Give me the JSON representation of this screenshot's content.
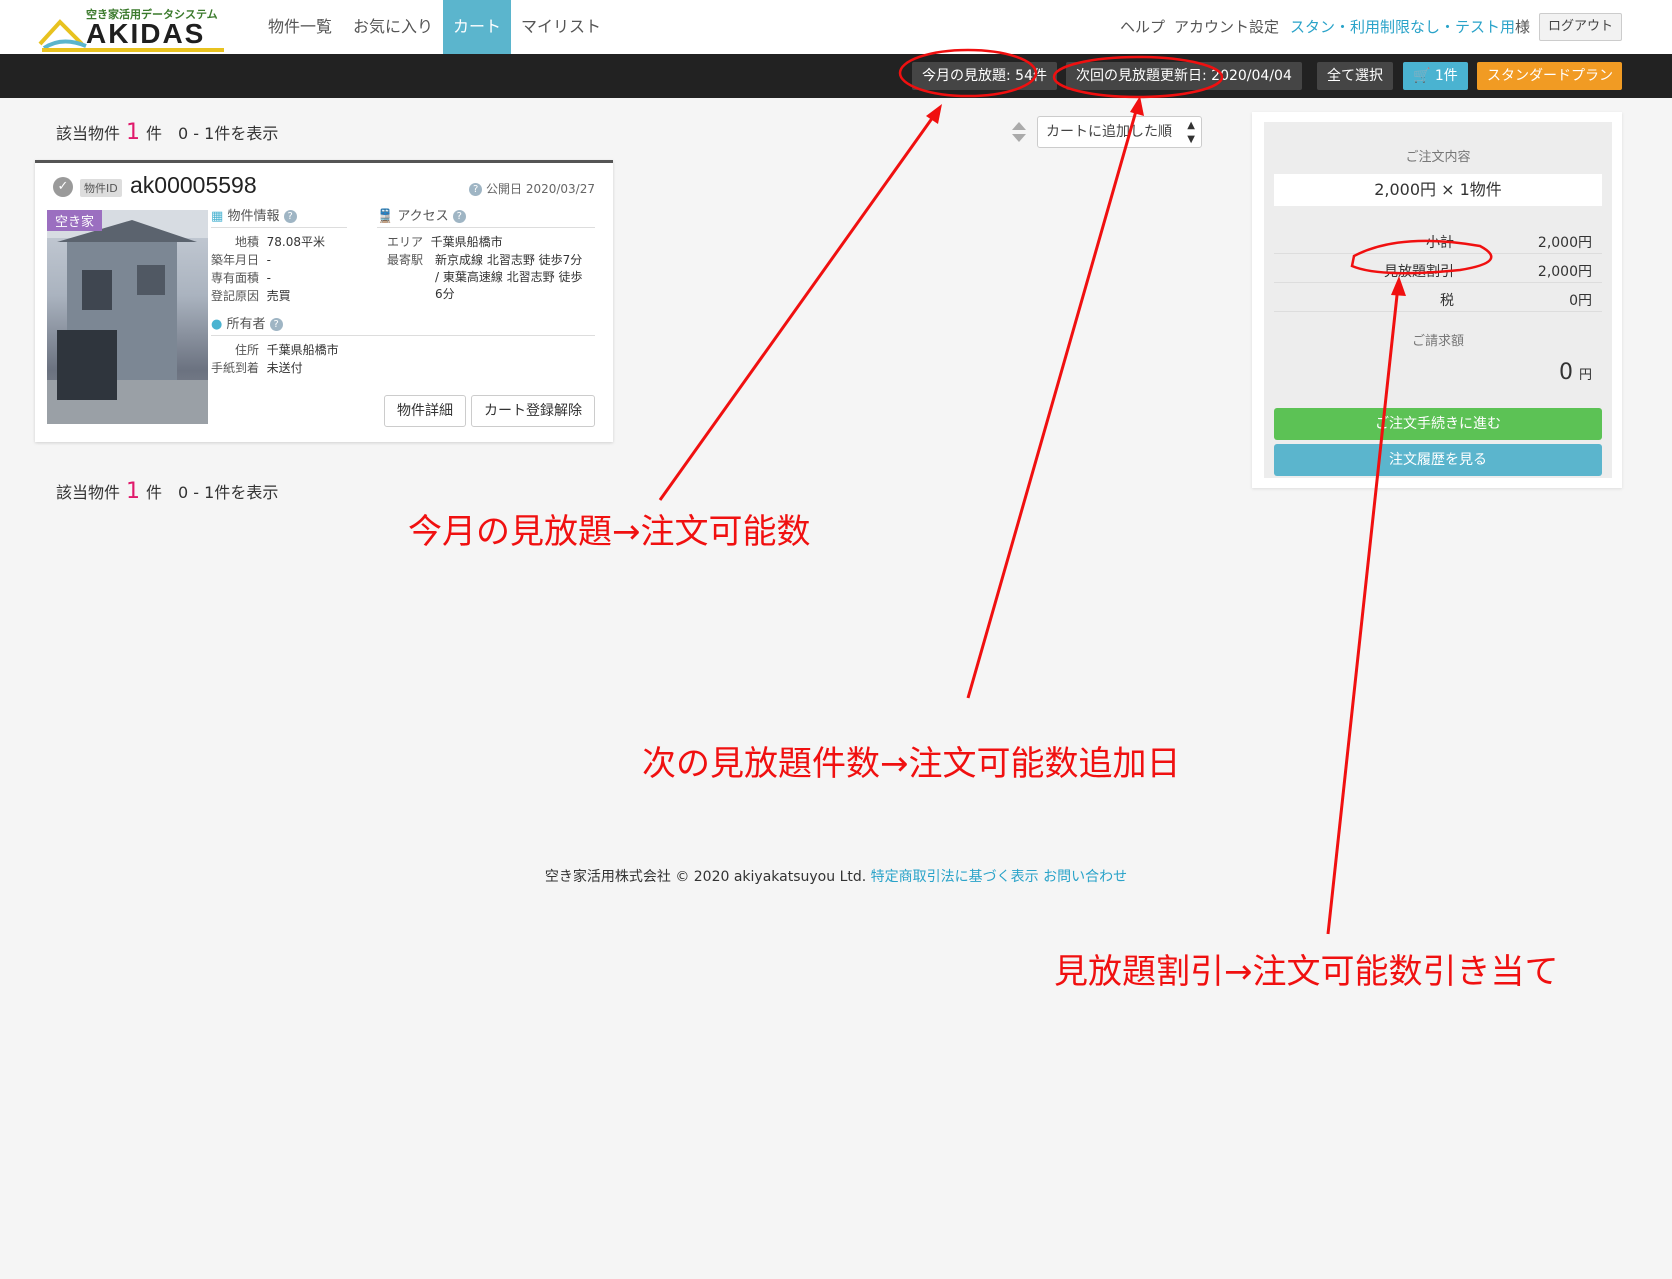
{
  "logo": {
    "tagline": "空き家活用データシステム",
    "name": "AKIDAS"
  },
  "nav": {
    "items": [
      {
        "label": "物件一覧"
      },
      {
        "label": "お気に入り"
      },
      {
        "label": "カート"
      },
      {
        "label": "マイリスト"
      }
    ]
  },
  "account": {
    "help": "ヘルプ",
    "settings": "アカウント設定",
    "user": "スタン・利用制限なし・テスト用",
    "honorific": "様",
    "logout": "ログアウト"
  },
  "toolbar": {
    "monthly": "今月の見放題: 54件",
    "next_update": "次回の見放題更新日: 2020/04/04",
    "select_all": "全て選択",
    "cart": "1件",
    "plan": "スタンダードプラン"
  },
  "results": {
    "prefix": "該当物件",
    "count": "1",
    "suffix": "件　0 - 1件を表示"
  },
  "sort": {
    "selected": "カートに追加した順"
  },
  "property": {
    "id_label": "物件ID",
    "id": "ak00005598",
    "published": "公開日 2020/03/27",
    "badge": "空き家",
    "info_title": "物件情報",
    "info": [
      {
        "k": "地積",
        "v": "78.08平米"
      },
      {
        "k": "築年月日",
        "v": "-"
      },
      {
        "k": "専有面積",
        "v": "-"
      },
      {
        "k": "登記原因",
        "v": "売買"
      }
    ],
    "access_title": "アクセス",
    "area_label": "エリア",
    "area": "千葉県船橋市",
    "station_label": "最寄駅",
    "station_lines": [
      "新京成線 北習志野 徒歩7分",
      "/ 東葉高速線 北習志野 徒歩",
      "6分"
    ],
    "owner_title": "所有者",
    "owner": [
      {
        "k": "住所",
        "v": "千葉県船橋市"
      },
      {
        "k": "手紙到着",
        "v": "未送付"
      }
    ],
    "detail_button": "物件詳細",
    "remove_button": "カート登録解除"
  },
  "order": {
    "title": "ご注文内容",
    "summary": "2,000円 × 1物件",
    "subtotal_label": "小計",
    "subtotal": "2,000円",
    "discount_label": "見放題割引",
    "discount": "2,000円",
    "tax_label": "税",
    "tax": "0円",
    "bill_label": "ご請求額",
    "bill": "0",
    "bill_unit": "円",
    "proceed_button": "ご注文手続きに進む",
    "history_button": "注文履歴を見る"
  },
  "footer": {
    "copyright": "空き家活用株式会社 © 2020 akiyakatsuyou Ltd.",
    "law_link": "特定商取引法に基づく表示",
    "contact_link": "お問い合わせ"
  },
  "annotations": {
    "a1": "今月の見放題→注文可能数",
    "a2": "次の見放題件数→注文可能数追加日",
    "a3": "見放題割引→注文可能数引き当て"
  },
  "colors": {
    "accent": "#5bb5cd",
    "cart_pill": "#4ab3d1",
    "plan_pill": "#f19b23",
    "proceed": "#5cc255",
    "history": "#5bb5cd",
    "annotation": "#f01010"
  }
}
